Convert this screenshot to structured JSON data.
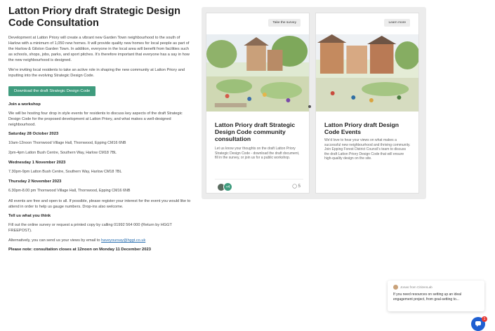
{
  "left": {
    "title": "Latton Priory draft Strategic Design Code Consultation",
    "intro": "Development at Latton Priory will create a vibrant new Garden Town neighbourhood to the south of Harlow with a minimum of 1,050 new homes. It will provide quality new homes for local people as part of the Harlow & Gilston Garden Town. In addition, everyone in the local area will benefit from facilities such as schools, shops, jobs, parks, and sport pitches. It's therefore important that everyone has a say in how the new neighbourhood is designed.",
    "invite": "We're inviting local residents to take an active role in shaping the new community at Latton Priory and inputting into the evolving Strategic Design Code.",
    "download_label": "Download the draft Strategic Design Code",
    "workshop_heading": "Join a workshop",
    "workshop_text": "We will be hosting four drop in style events for residents to discuss key aspects of the draft Strategic Design Code for the proposed development at Latton Priory, and what makes a well-designed neighbourhood.",
    "date1": "Saturday 28 October 2023",
    "event1a": "10am-12noon Thornwood Village Hall, Thornwood, Epping CM16 6NB",
    "event1b": "2pm-4pm Latton Bush Centre, Southern Way, Harlow CM18 7BL",
    "date2": "Wednesday 1 November 2023",
    "event2": "7.30pm-9pm Latton Bush Centre, Southern Way, Harlow CM18 7BL",
    "date3": "Thursday 2 November 2023",
    "event3": "6.30pm-8.00 pm Thornwood Village Hall, Thornwood, Epping CM16 6NB",
    "free_text": "All events are free and open to all. If possible, please register your interest for the event you would like to attend in order to help us gauge numbers. Drop-ins also welcome.",
    "tell_heading": "Tell us what you think",
    "tell_text": "Fill out the online survey or request a printed copy by calling 01992 564 000 (Return by HGGT FREEPOST).",
    "email_text": "Alternatively, you can send us your views by email to ",
    "email_link": "haveyoursay@hggt.co.uk",
    "closing_note": "Please note: consultation closes at 12noon on Monday 11 December 2023"
  },
  "cards": [
    {
      "button": "Take the survey",
      "title": "Latton Priory draft Strategic Design Code community consultation",
      "desc": "Let us know your thoughts on the draft Latton Priory Strategic Design Code - download the draft document, fill in the survey, or join us for a public workshop.",
      "avatars_more": "+4",
      "ideas_count": "5"
    },
    {
      "button": "Learn more",
      "title": "Latton Priory draft Design Code Events",
      "desc": "We'd love to hear your views on what makes a successful new neighbourhood and thriving community. Join Epping Forest District Council's team to discuss the draft Latton Priory Design Code that will ensure high-quality design on the site."
    }
  ],
  "chat": {
    "from": "Jonas from CitizenLab",
    "message": "If you need resources on setting up an ideal engagement project, from goal-setting to...",
    "badge": "1"
  }
}
